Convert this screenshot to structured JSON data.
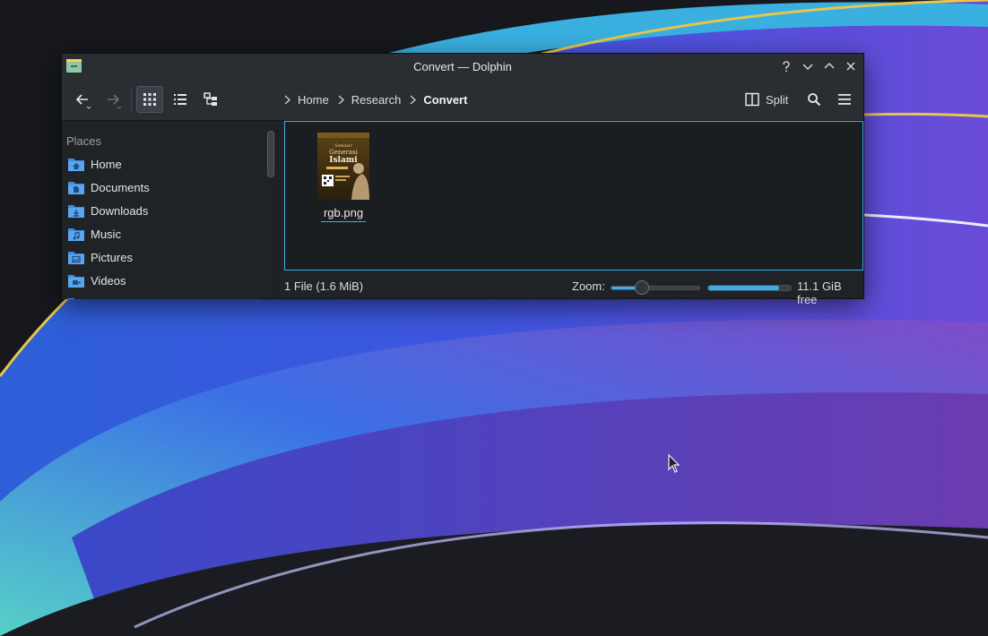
{
  "window": {
    "title": "Convert — Dolphin",
    "controls": [
      "help-icon",
      "minimize-icon",
      "maximize-icon",
      "close-icon"
    ]
  },
  "toolbar": {
    "back_icon": "arrow-left-icon",
    "forward_icon": "arrow-right-icon",
    "view_modes": [
      {
        "name": "icons-view",
        "icon": "grid-icon",
        "active": true
      },
      {
        "name": "details-view",
        "icon": "list-icon",
        "active": false
      },
      {
        "name": "tree-view",
        "icon": "tree-icon",
        "active": false
      }
    ],
    "breadcrumbs": [
      "Home",
      "Research",
      "Convert"
    ],
    "split_label": "Split",
    "search_icon": "search-icon",
    "menu_icon": "hamburger-menu-icon"
  },
  "sidebar": {
    "header": "Places",
    "items": [
      {
        "label": "Home",
        "icon": "folder-home-icon"
      },
      {
        "label": "Documents",
        "icon": "folder-documents-icon"
      },
      {
        "label": "Downloads",
        "icon": "folder-downloads-icon"
      },
      {
        "label": "Music",
        "icon": "folder-music-icon"
      },
      {
        "label": "Pictures",
        "icon": "folder-pictures-icon"
      },
      {
        "label": "Videos",
        "icon": "folder-videos-icon"
      }
    ]
  },
  "files": [
    {
      "name": "rgb.png",
      "thumbnail_text": [
        "Seminar",
        "Generasi",
        "Islami"
      ]
    }
  ],
  "status": {
    "summary": "1 File (1.6 MiB)",
    "zoom_label": "Zoom:",
    "zoom_level": 0.35,
    "disk_used_fraction": 0.86,
    "free_space": "11.1 GiB free"
  },
  "colors": {
    "accent": "#3daee9",
    "window_bg": "#202326",
    "view_bg": "#1b1e20",
    "folder": "#3d8fe0"
  }
}
